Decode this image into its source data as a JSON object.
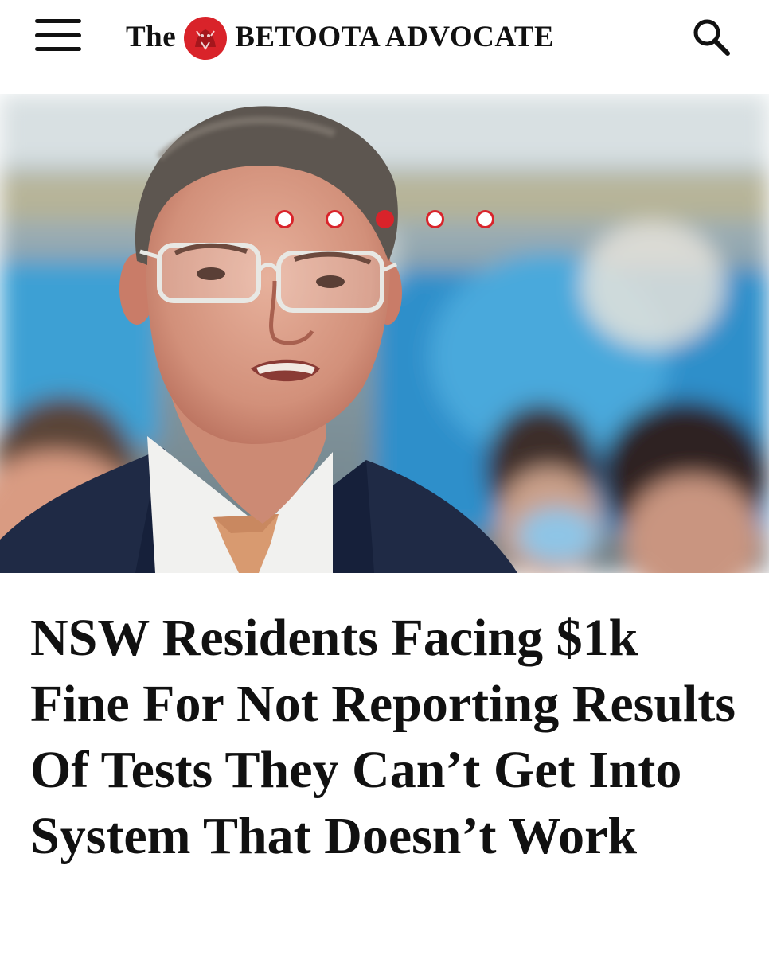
{
  "header": {
    "brand_prefix": "The",
    "brand_name": "BETOOTA ADVOCATE"
  },
  "colors": {
    "accent": "#d9232a",
    "text": "#111111",
    "background": "#ffffff"
  },
  "icons": {
    "menu": "hamburger-menu-icon",
    "search": "search-icon",
    "logo": "betoota-logo-icon"
  },
  "carousel": {
    "slide_count": 5,
    "active_index": 2
  },
  "article": {
    "headline": "NSW Residents Facing $1k Fine For Not Reporting Results Of Tests They Can’t Get Into System That Doesn’t Work"
  }
}
